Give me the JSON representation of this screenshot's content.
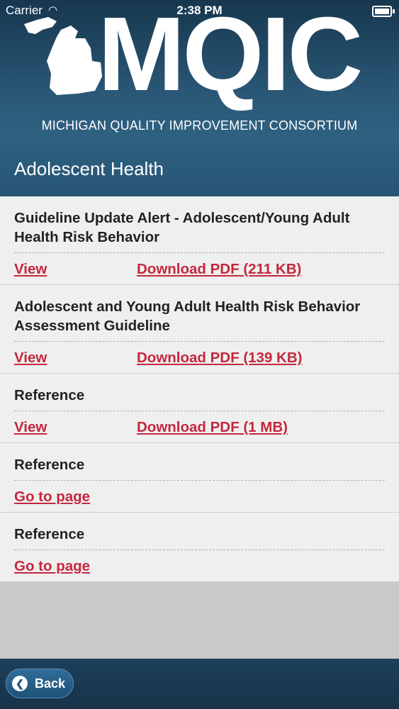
{
  "status_bar": {
    "carrier": "Carrier",
    "time": "2:38 PM"
  },
  "header": {
    "logo_text": "MQIC",
    "org_name": "MICHIGAN QUALITY IMPROVEMENT CONSORTIUM"
  },
  "page": {
    "title": "Adolescent Health"
  },
  "items": [
    {
      "heading": "Guideline Update Alert - Adolescent/Young Adult Health Risk Behavior",
      "view_label": "View",
      "download_label": "Download PDF (211 KB)"
    },
    {
      "heading": "Adolescent and Young Adult Health Risk Behavior Assessment Guideline",
      "view_label": "View",
      "download_label": "Download PDF (139 KB)"
    },
    {
      "heading": "Reference",
      "view_label": "View",
      "download_label": "Download PDF (1 MB)"
    },
    {
      "heading": "Reference",
      "link_label": "Go to page"
    },
    {
      "heading": "Reference",
      "link_label": "Go to page"
    }
  ],
  "footer": {
    "back_label": "Back"
  },
  "colors": {
    "link": "#c4283e",
    "header": "#2b5978",
    "background": "#c9c9c9"
  }
}
